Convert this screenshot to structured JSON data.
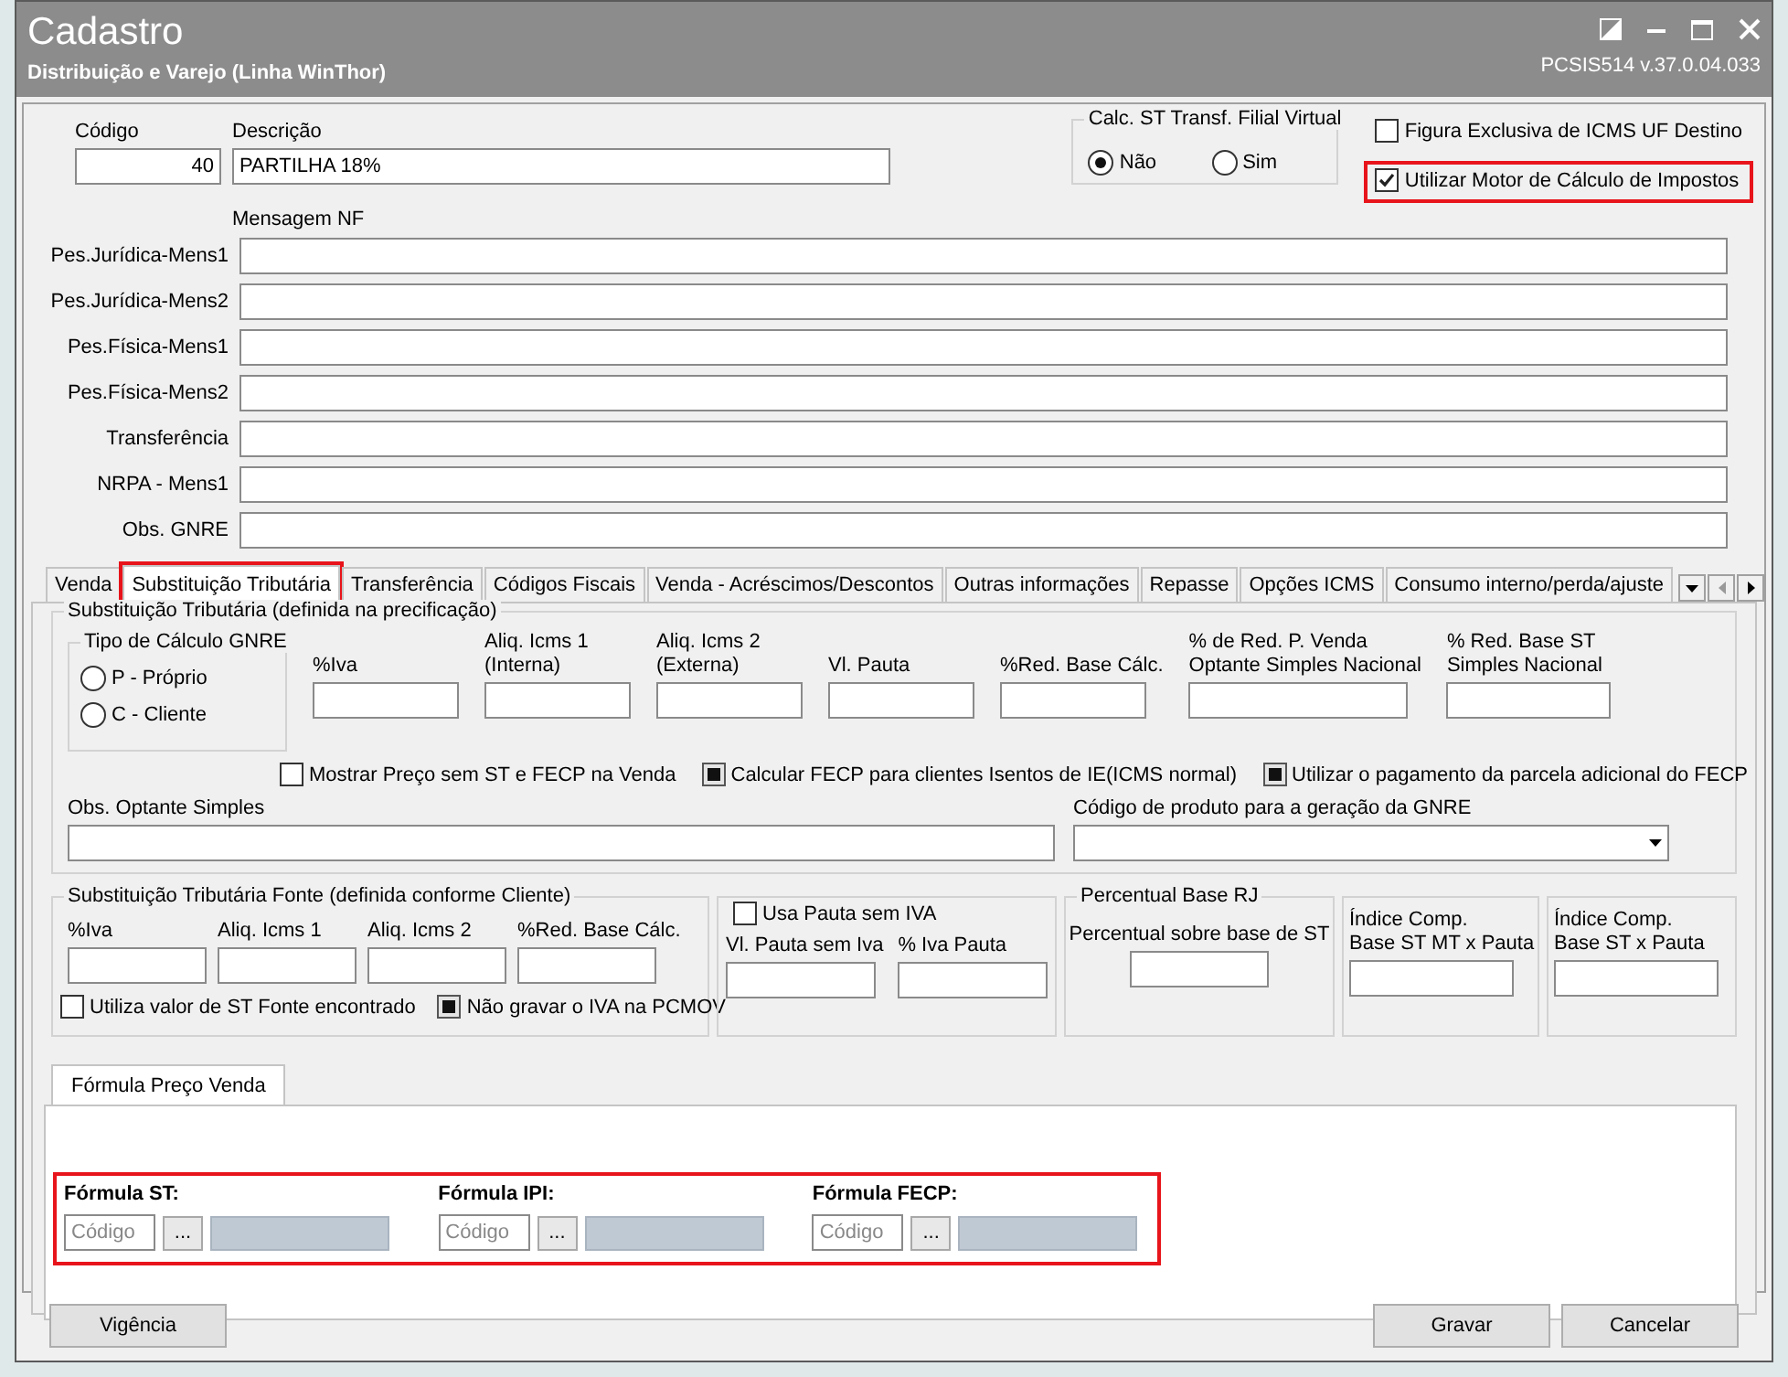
{
  "window": {
    "title": "Cadastro",
    "subtitle": "Distribuição e Varejo (Linha WinThor)",
    "version": "PCSIS514  v.37.0.04.033"
  },
  "header": {
    "codigo": {
      "label": "Código",
      "value": "40"
    },
    "descricao": {
      "label": "Descrição",
      "value": "PARTILHA 18%"
    },
    "calc_st": {
      "title": "Calc. ST Transf. Filial Virtual",
      "options": [
        {
          "label": "Não",
          "selected": true
        },
        {
          "label": "Sim",
          "selected": false
        }
      ]
    },
    "checks": [
      {
        "label": "Figura Exclusiva de ICMS UF Destino",
        "checked": false,
        "highlighted": false
      },
      {
        "label": "Utilizar Motor de Cálculo de Impostos",
        "checked": true,
        "highlighted": true
      }
    ]
  },
  "mensagem_nf": {
    "title": "Mensagem NF",
    "fields": [
      {
        "label": "Pes.Jurídica-Mens1"
      },
      {
        "label": "Pes.Jurídica-Mens2"
      },
      {
        "label": "Pes.Física-Mens1"
      },
      {
        "label": "Pes.Física-Mens2"
      },
      {
        "label": "Transferência"
      },
      {
        "label": "NRPA - Mens1"
      },
      {
        "label": "Obs. GNRE"
      }
    ]
  },
  "tabs": [
    {
      "label": "Venda",
      "selected": false,
      "highlighted": false
    },
    {
      "label": "Substituição Tributária",
      "selected": true,
      "highlighted": true
    },
    {
      "label": "Transferência",
      "selected": false,
      "highlighted": false
    },
    {
      "label": "Códigos Fiscais",
      "selected": false,
      "highlighted": false
    },
    {
      "label": "Venda - Acréscimos/Descontos",
      "selected": false,
      "highlighted": false
    },
    {
      "label": "Outras informações",
      "selected": false,
      "highlighted": false
    },
    {
      "label": "Repasse",
      "selected": false,
      "highlighted": false
    },
    {
      "label": "Opções ICMS",
      "selected": false,
      "highlighted": false
    },
    {
      "label": "Consumo interno/perda/ajuste",
      "selected": false,
      "highlighted": false
    }
  ],
  "st_group": {
    "title": "Substituição Tributária (definida na precificação)",
    "gnre": {
      "title": "Tipo de Cálculo GNRE",
      "options": [
        {
          "label": "P - Próprio",
          "selected": false
        },
        {
          "label": "C - Cliente",
          "selected": false
        }
      ]
    },
    "fields": [
      {
        "label": "%Iva"
      },
      {
        "label": "Aliq. Icms 1\n(Interna)"
      },
      {
        "label": "Aliq. Icms 2\n(Externa)"
      },
      {
        "label": "Vl. Pauta"
      },
      {
        "label": "%Red. Base Cálc."
      },
      {
        "label": "% de Red. P. Venda\nOptante Simples Nacional"
      },
      {
        "label": "% Red. Base ST\nSimples Nacional"
      }
    ],
    "checks": [
      {
        "label": "Mostrar Preço sem ST e FECP na Venda",
        "checked": false,
        "grayed": false
      },
      {
        "label": "Calcular FECP para clientes Isentos de IE(ICMS normal)",
        "checked": true,
        "grayed": true
      },
      {
        "label": "Utilizar o pagamento da parcela adicional do FECP",
        "checked": true,
        "grayed": true
      }
    ],
    "obs": {
      "label": "Obs. Optante Simples"
    },
    "gnre_product": {
      "label": "Código de produto para a geração da GNRE"
    }
  },
  "fonte_group": {
    "title": "Substituição Tributária Fonte (definida conforme Cliente)",
    "fields": [
      {
        "label": "%Iva"
      },
      {
        "label": "Aliq. Icms 1"
      },
      {
        "label": "Aliq. Icms 2"
      },
      {
        "label": "%Red. Base Cálc."
      }
    ],
    "checks": [
      {
        "label": "Utiliza valor de ST Fonte encontrado",
        "checked": false,
        "grayed": false
      },
      {
        "label": "Não gravar o IVA na PCMOV",
        "checked": true,
        "grayed": true
      }
    ]
  },
  "pauta_group": {
    "check": {
      "label": "Usa Pauta sem IVA",
      "checked": false,
      "grayed": false
    },
    "fields": [
      {
        "label": "Vl. Pauta sem Iva"
      },
      {
        "label": "% Iva Pauta"
      }
    ]
  },
  "rj_group": {
    "title": "Percentual Base RJ",
    "fields": [
      {
        "label": "Percentual sobre base de ST"
      }
    ]
  },
  "indice_groups": [
    {
      "label": "Índice Comp.\nBase ST MT x Pauta"
    },
    {
      "label": "Índice Comp.\nBase ST x Pauta"
    }
  ],
  "formula": {
    "tabs": [
      {
        "label": "Fórmula Preço Venda",
        "selected": true
      }
    ],
    "highlighted": true,
    "items": [
      {
        "label": "Fórmula ST:",
        "placeholder": "Código",
        "button": "..."
      },
      {
        "label": "Fórmula IPI:",
        "placeholder": "Código",
        "button": "..."
      },
      {
        "label": "Fórmula FECP:",
        "placeholder": "Código",
        "button": "..."
      }
    ]
  },
  "footer": {
    "left_buttons": [
      {
        "label": "Vigência"
      }
    ],
    "right_buttons": [
      {
        "label": "Gravar"
      },
      {
        "label": "Cancelar"
      }
    ]
  }
}
